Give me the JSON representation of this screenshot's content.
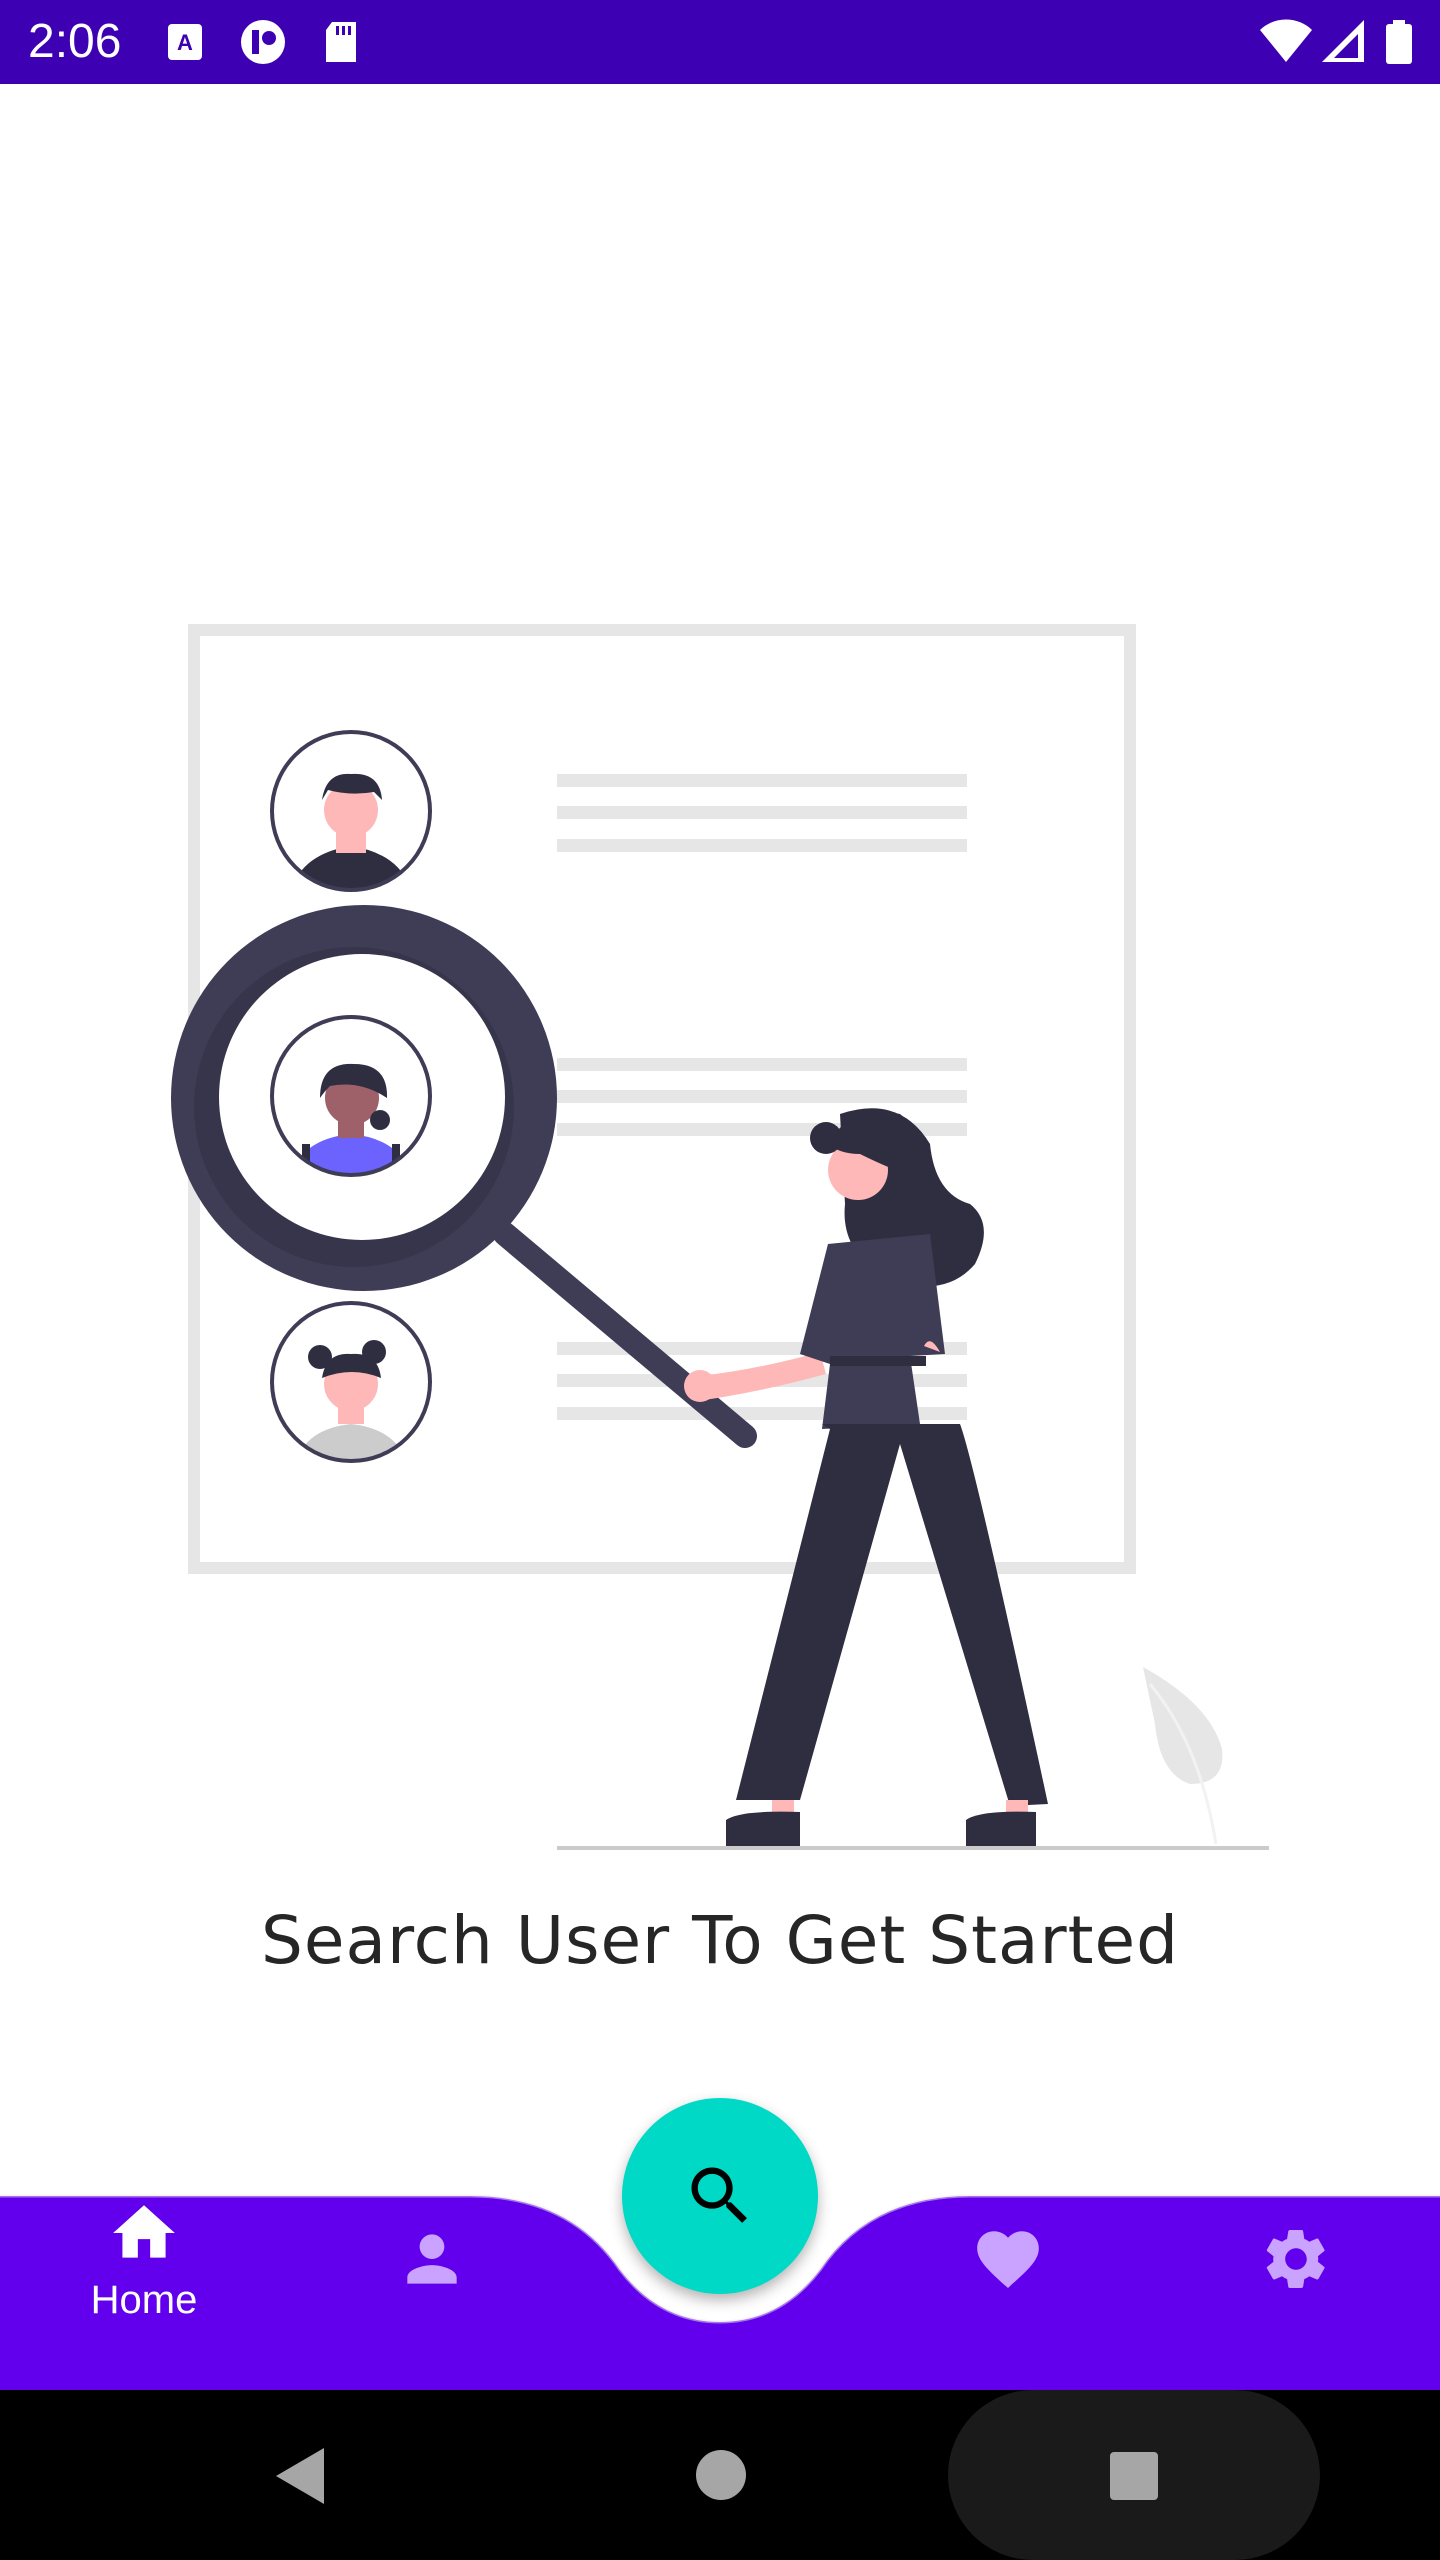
{
  "status_bar": {
    "time": "2:06",
    "left_icons": [
      "font-a-icon",
      "record-icon",
      "sd-card-icon"
    ],
    "right_icons": [
      "wifi-icon",
      "cell-signal-icon",
      "battery-icon"
    ],
    "background": "#3d00b3"
  },
  "main": {
    "headline": "Search User To Get Started",
    "illustration": "search-users-illustration"
  },
  "bottom_nav": {
    "background": "#6200ee",
    "items": [
      {
        "name": "home",
        "label": "Home",
        "icon": "home-icon",
        "active": true
      },
      {
        "name": "profile",
        "label": "",
        "icon": "person-icon",
        "active": false
      },
      {
        "name": "favorites",
        "label": "",
        "icon": "heart-icon",
        "active": false
      },
      {
        "name": "settings",
        "label": "",
        "icon": "gear-icon",
        "active": false
      }
    ],
    "fab": {
      "icon": "search-icon",
      "color": "#00d9c6"
    }
  },
  "system_nav": {
    "buttons": [
      "back-icon",
      "home-circle-icon",
      "recents-icon"
    ]
  }
}
